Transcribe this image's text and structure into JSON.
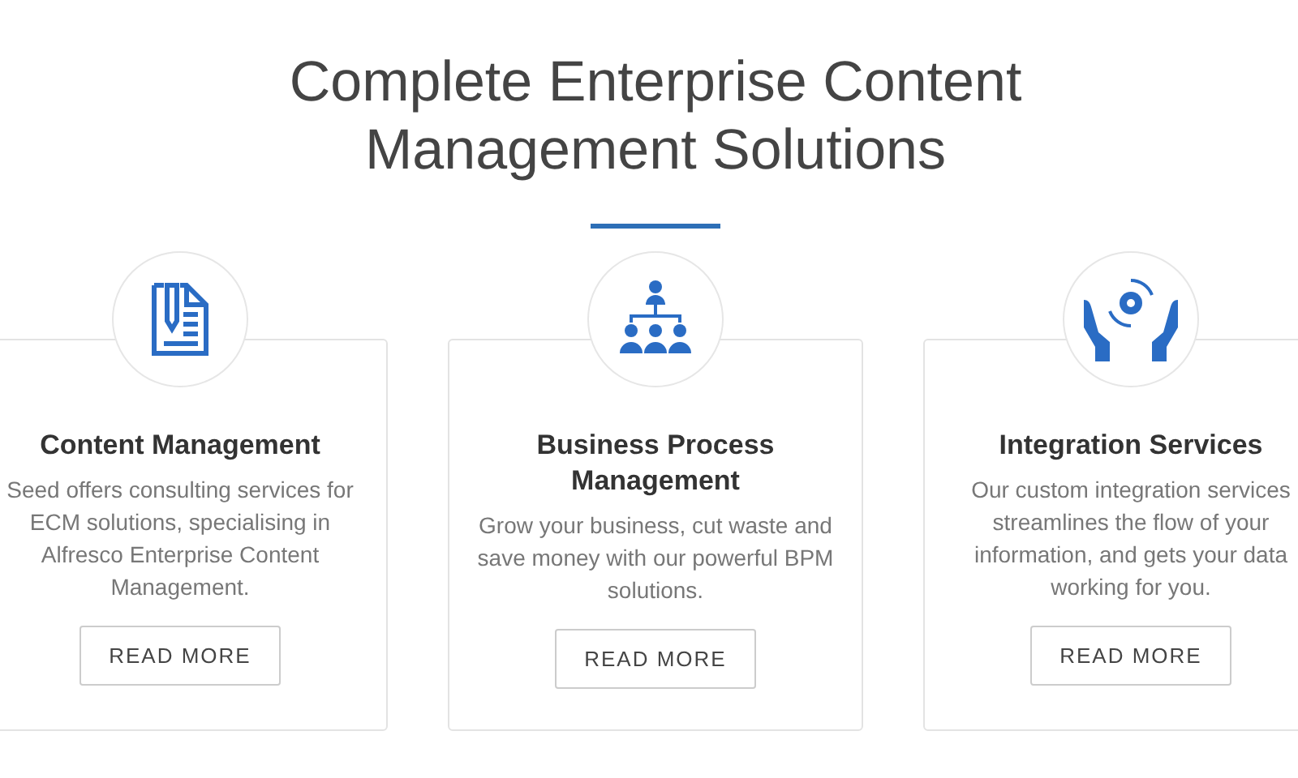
{
  "heading": "Complete Enterprise Content Management Solutions",
  "cards": [
    {
      "kind": "document",
      "title": "Content Management",
      "text": "Seed offers consulting services for ECM solutions, specialising in Alfresco Enterprise Content Management.",
      "button": "READ MORE"
    },
    {
      "kind": "hierarchy",
      "title": "Business Process Management",
      "text": "Grow your business, cut waste and save money with our powerful BPM solutions.",
      "button": "READ MORE"
    },
    {
      "kind": "hands",
      "title": "Integration Services",
      "text": "Our custom integration services streamlines the flow of your information, and gets your data working for you.",
      "button": "READ MORE"
    }
  ]
}
